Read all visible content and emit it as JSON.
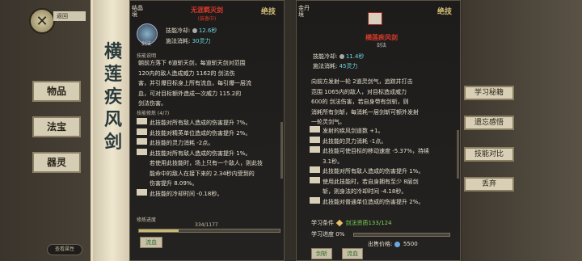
{
  "back": {
    "label": "返回"
  },
  "left_scroll_title": "横莲疾风剑",
  "side_tabs": [
    "物品",
    "法宝",
    "器灵"
  ],
  "view_button": "查看属性",
  "panel1": {
    "realm": "结晶境",
    "skill_name": "无涯羁灭剑",
    "status": "(装备中)",
    "stamp": "绝技",
    "icon_tag": "剑法",
    "cooldown_label": "技能冷却:",
    "cooldown_value": "12.6秒",
    "cost_label": "施法消耗:",
    "cost_value": "30灵力",
    "desc_header": "技能说明",
    "desc": [
      "朝前方落下 6道斩天剑，每道斩天剑对范围",
      "120内的敌人造成威力 1162的 剑法伤",
      "害，并引爆目标身上所有流血，每引爆一层流",
      "血，可对目标额外造成一次威力 115.2的",
      "剑法伤害。"
    ],
    "cult_header": "技能修炼 (4/7)",
    "cult_lines": [
      {
        "tag": "",
        "text": "此技能对所有敌人造成的伤害提升 7%。",
        "color": "red"
      },
      {
        "tag": "",
        "text": "此技能对精英单位造成的伤害提升 2%。",
        "color": "normal"
      },
      {
        "tag": "",
        "text": "此技能的灵力消耗 -2点。",
        "color": "normal"
      },
      {
        "tag": "",
        "text": "此技能对所有敌人造成的伤害提升 1%。",
        "color": "normal"
      },
      {
        "tag": "",
        "text": "若使用此技能时，场上只有一个敌人，则此技",
        "color": "normal"
      },
      {
        "tag": "",
        "text": "能命中的敌人在接下来的 2.34秒内受到的",
        "color": "normal"
      },
      {
        "tag": "",
        "text": "伤害提升 8.09%。",
        "color": "normal"
      },
      {
        "tag": "",
        "text": "此技能的冷却时间 -0.18秒。",
        "color": "normal"
      }
    ],
    "progress_label": "修炼进度",
    "progress_text": "334/1177",
    "progress_value": 0.284,
    "practice_button": "流血"
  },
  "panel2": {
    "realm": "金丹境",
    "skill_name": "横莲疾风剑",
    "stamp": "绝技",
    "icon_tag": "剑法",
    "cooldown_label": "技能冷却:",
    "cooldown_value": "11.4秒",
    "cost_label": "施法消耗:",
    "cost_value": "45灵力",
    "desc": [
      "向前方发射一轮 2道灵剑气，追踪并打击",
      "范围 1065内的敌人，对目标造成威力",
      "600的 剑法伤害，若自身带有剑斩，则",
      "消耗所有剑斩，每消耗一层剑斩可额外发射",
      "一轮灵剑气。"
    ],
    "cult_lines": [
      {
        "tag": "",
        "text": "发射的疾风剑道数 +1。",
        "color": "normal"
      },
      {
        "tag": "",
        "text": "此技能的灵力消耗 -1点。",
        "color": "normal"
      },
      {
        "tag": "",
        "text": "此技能可使目标的移动速度 -5.37%，持续",
        "color": "normal"
      },
      {
        "tag": "",
        "text": "3.1秒。",
        "color": "normal"
      },
      {
        "tag": "",
        "text": "此技能对所有敌人造成的伤害提升 1%。",
        "color": "normal"
      },
      {
        "tag": "",
        "text": "使用此技能时，若自身拥有至少 8层剑",
        "color": "purple"
      },
      {
        "tag": "",
        "text": "斩，则身法的冷却时间 -4.18秒。",
        "color": "purple"
      },
      {
        "tag": "",
        "text": "此技能对普通单位造成的伤害提升 2%。",
        "color": "normal"
      }
    ],
    "learn_label": "学习条件",
    "learn_value": "剑法资质133/124",
    "learn_progress_label": "学习进度",
    "learn_progress_value": "0%",
    "learn_progress_fraction": 0,
    "sell_label": "出售价格:",
    "sell_value": "5500",
    "btn_a": "剑斩",
    "btn_b": "流血"
  },
  "right_buttons": [
    "学习秘籍",
    "遗忘感悟",
    "技能对比",
    "丢弃"
  ]
}
